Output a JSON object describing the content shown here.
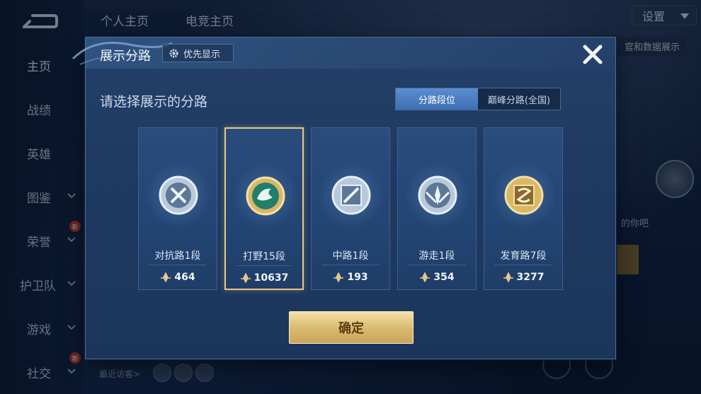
{
  "background": {
    "nav": [
      {
        "label": "主页",
        "active": true
      },
      {
        "label": "战绩"
      },
      {
        "label": "英雄"
      },
      {
        "label": "图鉴",
        "chevron": true
      },
      {
        "label": "荣誉",
        "chevron": true,
        "badge": "新"
      },
      {
        "label": "护卫队",
        "chevron": true
      },
      {
        "label": "游戏",
        "chevron": true
      },
      {
        "label": "社交",
        "chevron": true,
        "badge": "新"
      }
    ],
    "top_tabs": [
      "个人主页",
      "电竞主页"
    ],
    "settings_label": "设置",
    "note_fragment": "官和数据展示",
    "side_fragment": "的你吧",
    "visitors_label": "最近访客>"
  },
  "dialog": {
    "title": "展示分路",
    "priority_label": "优先显示",
    "subtitle": "请选择展示的分路",
    "segments": [
      {
        "label": "分路段位",
        "active": true
      },
      {
        "label": "巅峰分路(全国)",
        "active": false
      }
    ],
    "cards": [
      {
        "rank": "对抗路1段",
        "score": "464",
        "selected": false,
        "emblem": "sword-emblem-icon"
      },
      {
        "rank": "打野15段",
        "score": "10637",
        "selected": true,
        "emblem": "dragon-emblem-icon"
      },
      {
        "rank": "中路1段",
        "score": "193",
        "selected": false,
        "emblem": "staff-emblem-icon"
      },
      {
        "rank": "游走1段",
        "score": "354",
        "selected": false,
        "emblem": "wing-emblem-icon"
      },
      {
        "rank": "发育路7段",
        "score": "3277",
        "selected": false,
        "emblem": "arrow-emblem-icon"
      }
    ],
    "confirm_label": "确定"
  },
  "colors": {
    "accent_gold": "#e7c98a",
    "segment_active": "#4a7fc4",
    "panel": "#1f3a62"
  }
}
